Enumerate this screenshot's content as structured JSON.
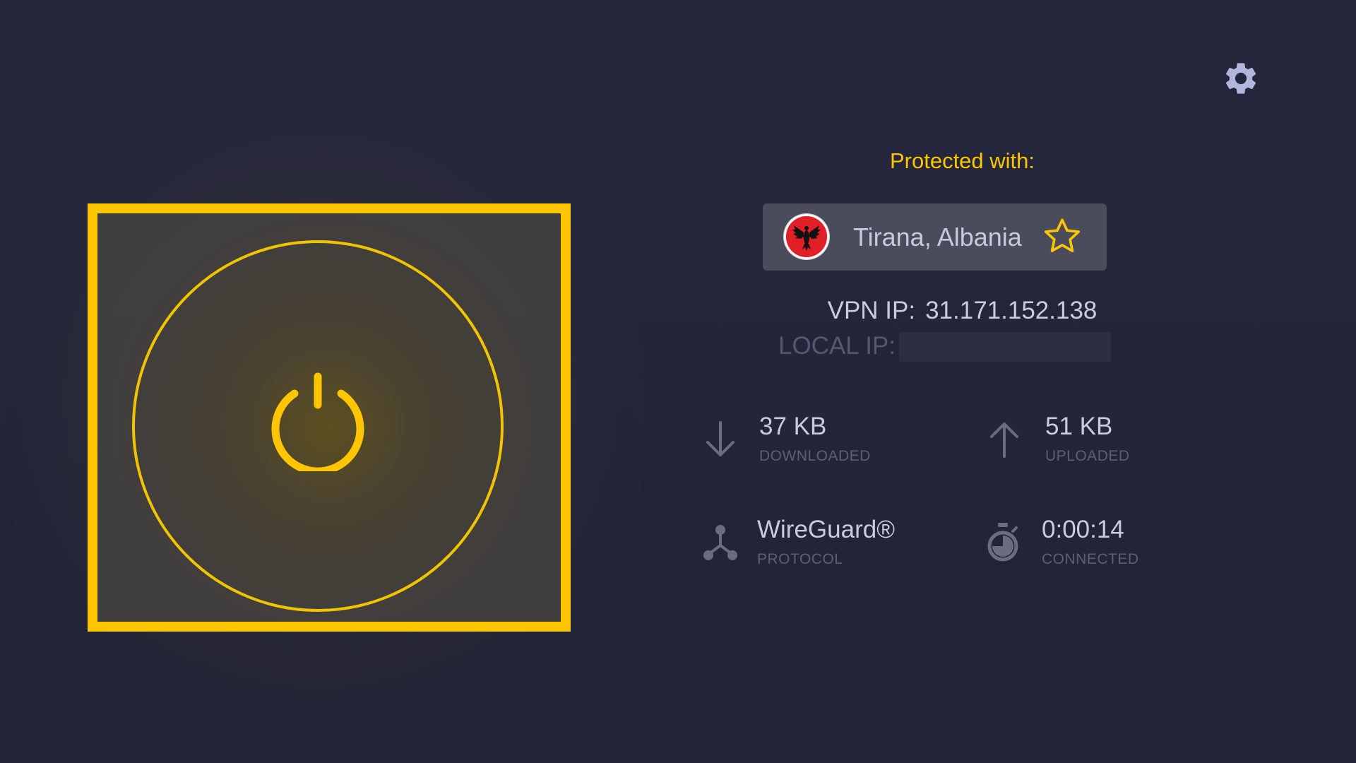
{
  "header": {
    "settings_icon": "gear-icon"
  },
  "power": {
    "icon": "power-icon",
    "state": "connected",
    "accent_color": "#ffc600"
  },
  "connection": {
    "protected_label": "Protected with:",
    "server_name": "Tirana, Albania",
    "flag_icon": "albania-flag-icon",
    "favorite_icon": "star-outline-icon",
    "vpn_ip_label": "VPN IP:",
    "vpn_ip_value": "31.171.152.138",
    "local_ip_label": "LOCAL IP:"
  },
  "stats": {
    "downloaded": {
      "value": "37 KB",
      "label": "DOWNLOADED",
      "icon": "arrow-down-icon"
    },
    "uploaded": {
      "value": "51 KB",
      "label": "UPLOADED",
      "icon": "arrow-up-icon"
    },
    "protocol": {
      "value": "WireGuard®",
      "label": "PROTOCOL",
      "icon": "protocol-icon"
    },
    "connected": {
      "value": "0:00:14",
      "label": "CONNECTED",
      "icon": "stopwatch-icon"
    }
  },
  "colors": {
    "background": "#23253a",
    "accent": "#ffc600",
    "card": "#4a4b5b",
    "text": "#c9cbe0",
    "muted_text": "#5d5f76"
  }
}
